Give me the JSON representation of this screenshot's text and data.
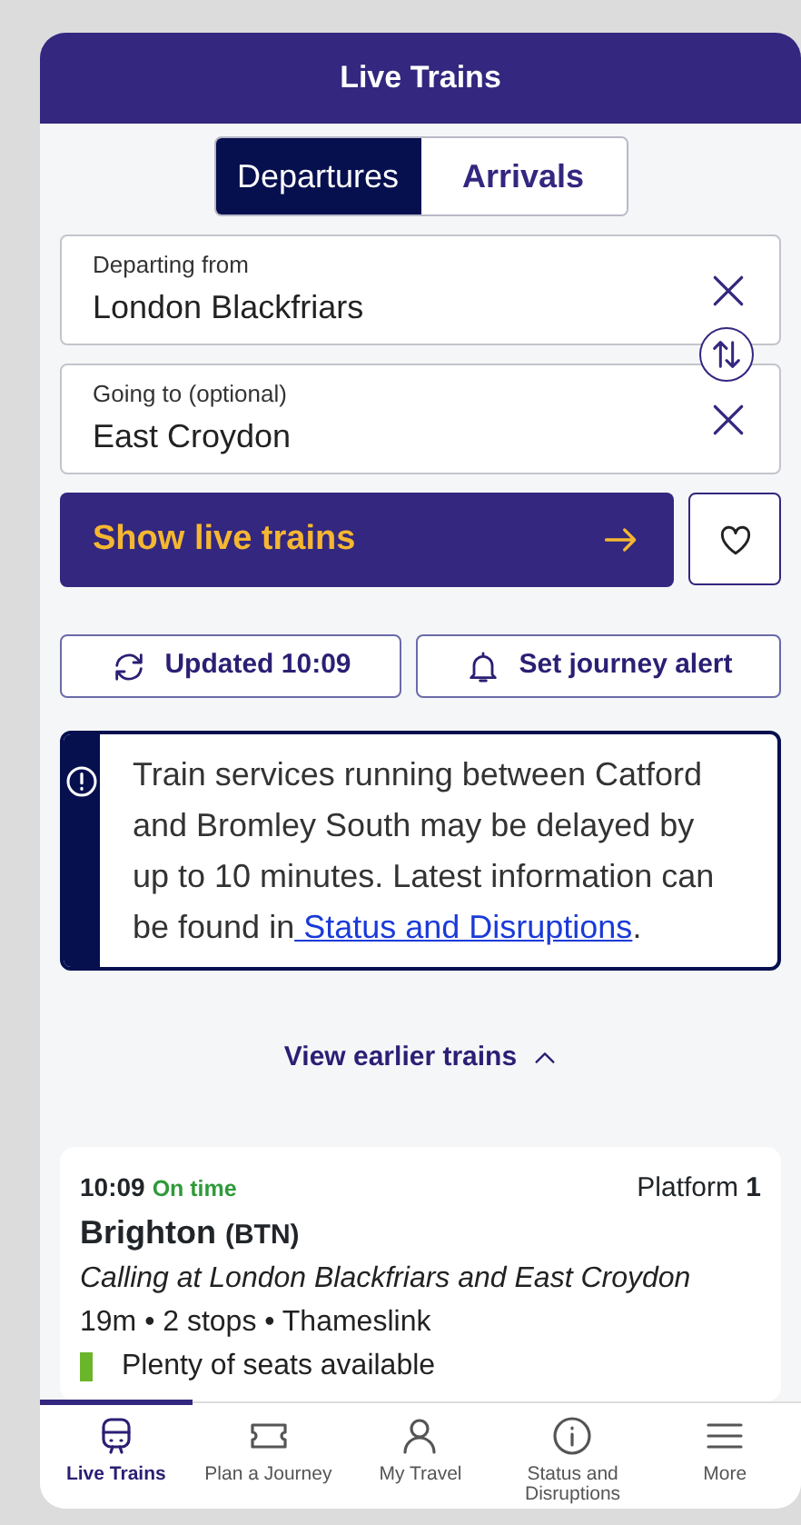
{
  "header": {
    "title": "Live Trains"
  },
  "direction_tabs": [
    {
      "label": "Departures",
      "selected": true
    },
    {
      "label": "Arrivals",
      "selected": false
    }
  ],
  "fields": [
    {
      "label": "Departing from",
      "value": "London Blackfriars"
    },
    {
      "label": "Going to (optional)",
      "value": "East Croydon"
    }
  ],
  "show_button": {
    "label": "Show live trains"
  },
  "actions": [
    {
      "kind": "refresh",
      "label": "Updated 10:09"
    },
    {
      "kind": "alert",
      "label": "Set journey alert"
    }
  ],
  "notice": {
    "text": "Train services running between Catford and Bromley South may be delayed by up to 10 minutes. Latest information can be found in",
    "link": " Status and Disruptions",
    "after": "."
  },
  "earlier": {
    "label": "View earlier trains"
  },
  "trains": [
    {
      "time": "10:09",
      "status": "On time",
      "platform": "Platform **1**",
      "destination": "Brighton",
      "code": "(BTN)",
      "calling": "Calling at London Blackfriars and East Croydon",
      "summary": "19m • 2 stops • Thameslink",
      "seats": "Plenty of seats available",
      "color": "#6bb52b"
    }
  ],
  "nav": [
    {
      "kind": "train",
      "label": "Live Trains",
      "selected": true
    },
    {
      "kind": "ticket",
      "label": "Plan a Journey",
      "selected": false
    },
    {
      "kind": "person",
      "label": "My Travel",
      "selected": false
    },
    {
      "kind": "info",
      "label": "Status and Disruptions",
      "selected": false
    },
    {
      "kind": "menu",
      "label": "More",
      "selected": false
    }
  ]
}
